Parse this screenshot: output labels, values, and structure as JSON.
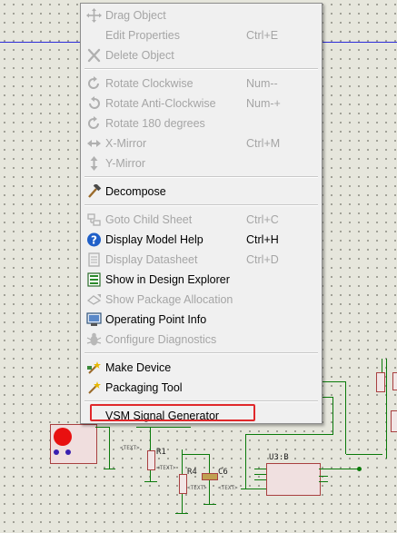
{
  "menu": {
    "items": [
      {
        "label": "Drag Object",
        "shortcut": "",
        "enabled": false,
        "icon": "move-icon"
      },
      {
        "label": "Edit Properties",
        "shortcut": "Ctrl+E",
        "enabled": false,
        "icon": ""
      },
      {
        "label": "Delete Object",
        "shortcut": "",
        "enabled": false,
        "icon": "delete-x-icon"
      },
      {
        "label": "Rotate Clockwise",
        "shortcut": "Num--",
        "enabled": false,
        "icon": "rotate-cw-icon"
      },
      {
        "label": "Rotate Anti-Clockwise",
        "shortcut": "Num-+",
        "enabled": false,
        "icon": "rotate-ccw-icon"
      },
      {
        "label": "Rotate 180 degrees",
        "shortcut": "",
        "enabled": false,
        "icon": "rotate-180-icon"
      },
      {
        "label": "X-Mirror",
        "shortcut": "Ctrl+M",
        "enabled": false,
        "icon": "x-mirror-icon"
      },
      {
        "label": "Y-Mirror",
        "shortcut": "",
        "enabled": false,
        "icon": "y-mirror-icon"
      },
      {
        "label": "Decompose",
        "shortcut": "",
        "enabled": true,
        "icon": "hammer-icon"
      },
      {
        "label": "Goto Child Sheet",
        "shortcut": "Ctrl+C",
        "enabled": false,
        "icon": "child-sheet-icon"
      },
      {
        "label": "Display Model Help",
        "shortcut": "Ctrl+H",
        "enabled": true,
        "icon": "help-icon"
      },
      {
        "label": "Display Datasheet",
        "shortcut": "Ctrl+D",
        "enabled": false,
        "icon": "datasheet-icon"
      },
      {
        "label": "Show in Design Explorer",
        "shortcut": "",
        "enabled": true,
        "icon": "design-explorer-icon"
      },
      {
        "label": "Show Package Allocation",
        "shortcut": "",
        "enabled": false,
        "icon": "package-allocation-icon"
      },
      {
        "label": "Operating Point Info",
        "shortcut": "",
        "enabled": true,
        "icon": "operating-point-icon"
      },
      {
        "label": "Configure Diagnostics",
        "shortcut": "",
        "enabled": false,
        "icon": "diagnostics-bug-icon"
      },
      {
        "label": "Make Device",
        "shortcut": "",
        "enabled": true,
        "icon": "make-device-icon"
      },
      {
        "label": "Packaging Tool",
        "shortcut": "",
        "enabled": true,
        "icon": "packaging-tool-icon"
      },
      {
        "label": "VSM Signal Generator",
        "shortcut": "",
        "enabled": true,
        "icon": ""
      }
    ]
  },
  "schematic": {
    "labels": {
      "r1": "R1",
      "r4": "R4",
      "c6": "C6",
      "u3": "U3:B",
      "text_placeholder": "<TEXT>"
    }
  },
  "colors": {
    "menu_bg": "#f0f0f0",
    "disabled_text": "#a5a5a5",
    "highlight_border": "#e0282b",
    "wire_green": "#0a7a0a",
    "wire_blue": "#2b2bd9"
  }
}
